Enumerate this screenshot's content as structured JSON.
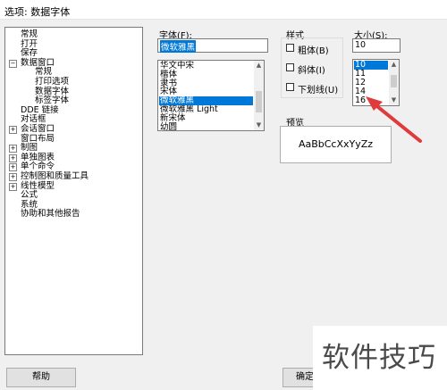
{
  "window": {
    "title": "选项: 数据字体"
  },
  "tree": {
    "items": [
      {
        "label": "常规"
      },
      {
        "label": "打开"
      },
      {
        "label": "保存"
      },
      {
        "label": "数据窗口",
        "toggle": "⊟"
      },
      {
        "label": "常规"
      },
      {
        "label": "打印选项"
      },
      {
        "label": "数据字体"
      },
      {
        "label": "标签字体"
      },
      {
        "label": "DDE 链接"
      },
      {
        "label": "对话框"
      },
      {
        "label": "会话窗口",
        "toggle": "⊞"
      },
      {
        "label": "窗口布局"
      },
      {
        "label": "制图",
        "toggle": "⊞"
      },
      {
        "label": "单独图表",
        "toggle": "⊞"
      },
      {
        "label": "单个命令",
        "toggle": "⊞"
      },
      {
        "label": "控制图和质量工具",
        "toggle": "⊞"
      },
      {
        "label": "线性模型",
        "toggle": "⊞"
      },
      {
        "label": "公式"
      },
      {
        "label": "系统"
      },
      {
        "label": "协助和其他报告"
      }
    ]
  },
  "font": {
    "label": "字体(F):",
    "value": "微软雅黑",
    "options": [
      "华文中宋",
      "楷体",
      "隶书",
      "宋体",
      "微软雅黑",
      "微软雅黑 Light",
      "新宋体",
      "幼圆"
    ],
    "selected_index": 4
  },
  "style": {
    "label": "样式",
    "bold": "粗体(B)",
    "italic": "斜体(I)",
    "underline": "下划线(U)"
  },
  "size": {
    "label": "大小(S):",
    "value": "10",
    "options": [
      "10",
      "11",
      "12",
      "14",
      "16"
    ],
    "selected_index": 0
  },
  "preview": {
    "label": "预览",
    "sample": "AaBbCcXxYyZz"
  },
  "buttons": {
    "help": "帮助",
    "ok": "确定"
  },
  "watermark": "软件技巧",
  "colors": {
    "selection": "#0078d7",
    "annotation_arrow": "#e03a3a"
  }
}
